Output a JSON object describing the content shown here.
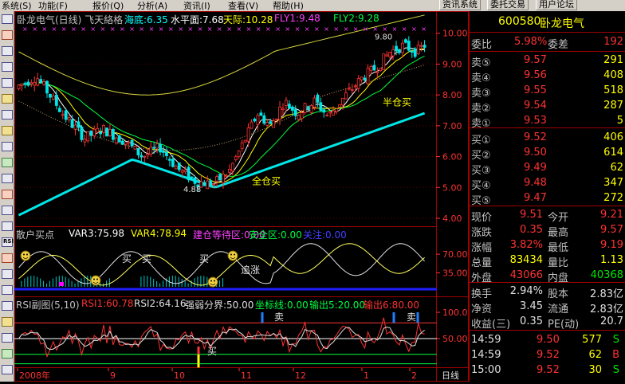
{
  "menubar": {
    "items": [
      "系统(S)",
      "功能(F)",
      "报价(Q)",
      "分析(A)",
      "资讯(I)",
      "查看(V)",
      "帮助(H)"
    ],
    "buttons": [
      "资讯系统",
      "委托交易",
      "用户论坛"
    ]
  },
  "main_chart": {
    "header": {
      "title": "卧龙电气(日线) 飞天絡格",
      "hd_label": "海底:6.35",
      "sp_label": "水平面:7.68",
      "tj_label": "天际:10.28",
      "fly1": "FLY1:9.48",
      "fly2": "FLY2:9.28"
    },
    "y_ticks": [
      "10.00",
      "9.00",
      "8.00",
      "7.00",
      "6.00",
      "5.00",
      "4.00"
    ],
    "annotations": {
      "quancang": "全仓买",
      "bancang": "半仓买",
      "low_label": "4.88",
      "high_label": "9.80"
    }
  },
  "sanhu_panel": {
    "title": "散户买点",
    "var3": "VAR3:75.98",
    "var4": "VAR4:78.94",
    "jiancang": "建仓等待区:0.00",
    "anquan": "安全区:0.00",
    "guanzhu": "关注:0.00",
    "y_ticks": [
      "70.00",
      "35.00"
    ],
    "mai": "买",
    "zhuizhang": "追涨"
  },
  "rsi_panel": {
    "title": "RSI副图(5,10)",
    "rsi1": "RSI1:60.78",
    "rsi2": "RSI2:64.16",
    "qrfj": "强弱分界:50.00",
    "zbx": "坐标线:0.00",
    "out5": "输出5:20.00",
    "out6": "输出6:80.00",
    "y_ticks": [
      "100.0",
      "50.00"
    ],
    "mai": "买",
    "mai_sell": "卖"
  },
  "x_axis": {
    "labels": [
      "2008年",
      "9",
      "10",
      "11",
      "12",
      "1",
      "2"
    ],
    "period": "日线"
  },
  "quote": {
    "code": "600580",
    "name": "卧龙电气",
    "weibi_label": "委比",
    "weibi": "5.98%",
    "weicha_label": "委差",
    "weicha": "192",
    "sells": [
      {
        "label": "卖⑤",
        "price": "9.57",
        "vol": "291"
      },
      {
        "label": "卖④",
        "price": "9.56",
        "vol": "408"
      },
      {
        "label": "卖③",
        "price": "9.55",
        "vol": "518"
      },
      {
        "label": "卖②",
        "price": "9.54",
        "vol": "287"
      },
      {
        "label": "卖①",
        "price": "9.53",
        "vol": "5"
      }
    ],
    "buys": [
      {
        "label": "买①",
        "price": "9.52",
        "vol": "406"
      },
      {
        "label": "买②",
        "price": "9.50",
        "vol": "614"
      },
      {
        "label": "买③",
        "price": "9.49",
        "vol": "62"
      },
      {
        "label": "买④",
        "price": "9.48",
        "vol": "347"
      },
      {
        "label": "买⑤",
        "price": "9.47",
        "vol": "272"
      }
    ],
    "stats": [
      {
        "l1": "现价",
        "v1": "9.51",
        "l2": "今开",
        "v2": "9.21"
      },
      {
        "l1": "涨跌",
        "v1": "0.35",
        "l2": "最高",
        "v2": "9.57"
      },
      {
        "l1": "涨幅",
        "v1": "3.82%",
        "l2": "最低",
        "v2": "9.19"
      },
      {
        "l1": "总量",
        "v1": "83434",
        "l2": "量比",
        "v2": "1.13"
      },
      {
        "l1": "外盘",
        "v1": "43066",
        "l2": "内盘",
        "v2": "40368"
      }
    ],
    "stats2": [
      {
        "l1": "换手",
        "v1": "2.94%",
        "l2": "股本",
        "v2": "2.83亿"
      },
      {
        "l1": "净资",
        "v1": "3.45",
        "l2": "流通",
        "v2": "2.83亿"
      },
      {
        "l1": "收益(三)",
        "v1": "0.35",
        "l2": "PE(动)",
        "v2": "20.7"
      }
    ],
    "ticks": [
      {
        "time": "14:59",
        "price": "9.50",
        "vol": "577",
        "side": "S"
      },
      {
        "time": "14:59",
        "price": "9.52",
        "vol": "62",
        "side": "B"
      },
      {
        "time": "15:00",
        "price": "9.52",
        "vol": "30",
        "side": "S"
      }
    ]
  },
  "colors": {
    "up": "#ff3232",
    "down": "#00e6e6",
    "bg": "#000000",
    "grid": "#a00000"
  }
}
